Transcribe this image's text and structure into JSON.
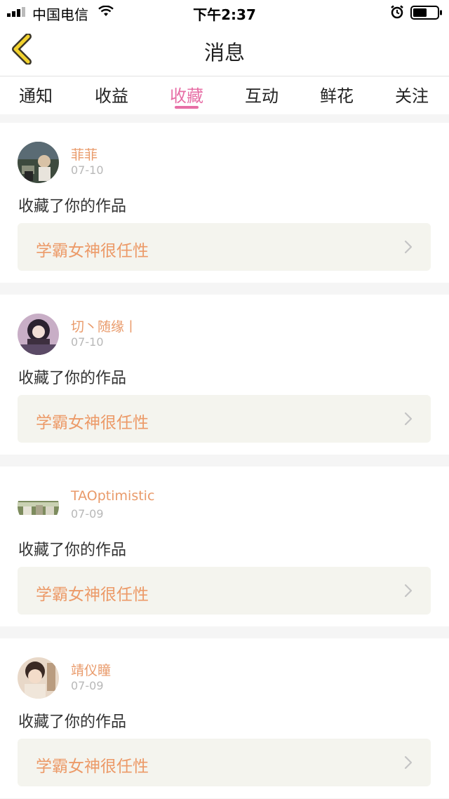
{
  "status_bar": {
    "carrier": "中国电信",
    "time": "下午2:37",
    "icons": [
      "signal-icon",
      "wifi-icon",
      "alarm-icon",
      "battery-icon"
    ]
  },
  "nav": {
    "title": "消息",
    "back_icon": "chevron-left-icon",
    "accent": "#f2d22e"
  },
  "tabs": [
    {
      "label": "通知"
    },
    {
      "label": "收益"
    },
    {
      "label": "收藏",
      "active": true
    },
    {
      "label": "互动"
    },
    {
      "label": "鲜花"
    },
    {
      "label": "关注"
    }
  ],
  "colors": {
    "active_tab": "#e76fa6",
    "username": "#e99a6a",
    "work_title": "#ec9a68",
    "work_bg": "#f4f4ee"
  },
  "messages": [
    {
      "username": "菲菲",
      "date": "07-10",
      "action": "收藏了你的作品",
      "work": "学霸女神很任性",
      "avatar_icon": "avatar-photo"
    },
    {
      "username": "切丶随缘丨",
      "date": "07-10",
      "action": "收藏了你的作品",
      "work": "学霸女神很任性",
      "avatar_icon": "avatar-photo"
    },
    {
      "username": "TAOptimistic",
      "date": "07-09",
      "action": "收藏了你的作品",
      "work": "学霸女神很任性",
      "avatar_icon": "avatar-photo"
    },
    {
      "username": "靖仪瞳",
      "date": "07-09",
      "action": "收藏了你的作品",
      "work": "学霸女神很任性",
      "avatar_icon": "avatar-photo"
    }
  ]
}
